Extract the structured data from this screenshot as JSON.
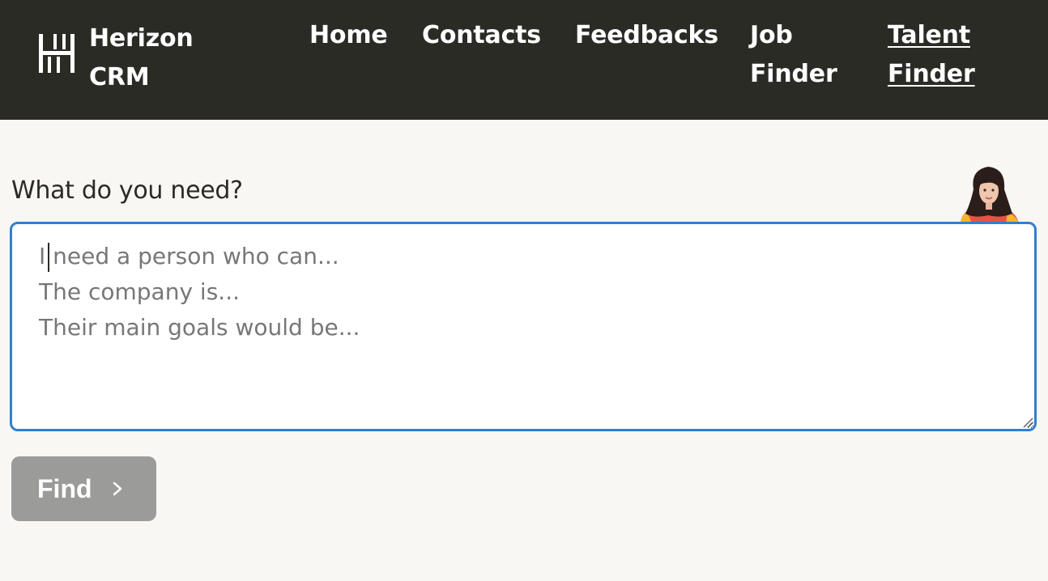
{
  "header": {
    "brand": {
      "line1": "Herizon",
      "line2": "CRM",
      "logo_icon": "herizon-h-logo-icon"
    },
    "nav": [
      {
        "line1": "Home",
        "line2": "",
        "active": false
      },
      {
        "line1": "Contacts",
        "line2": "",
        "active": false
      },
      {
        "line1": "Feedbacks",
        "line2": "",
        "active": false
      },
      {
        "line1": "Job",
        "line2": "Finder",
        "active": false
      },
      {
        "line1": "Talent",
        "line2": "Finder",
        "active": true
      }
    ],
    "background_color": "#2b2b26"
  },
  "main": {
    "prompt_label": "What do you need?",
    "avatar": "avatar-woman-photo",
    "request_input": {
      "value": "",
      "placeholder": "I need a person who can...\nThe company is...\nTheir main goals would be...",
      "border_color": "#2f7fd0"
    },
    "find_button": {
      "label": "Find",
      "icon": "chevron-right-icon",
      "color": "#9b9b99"
    }
  }
}
